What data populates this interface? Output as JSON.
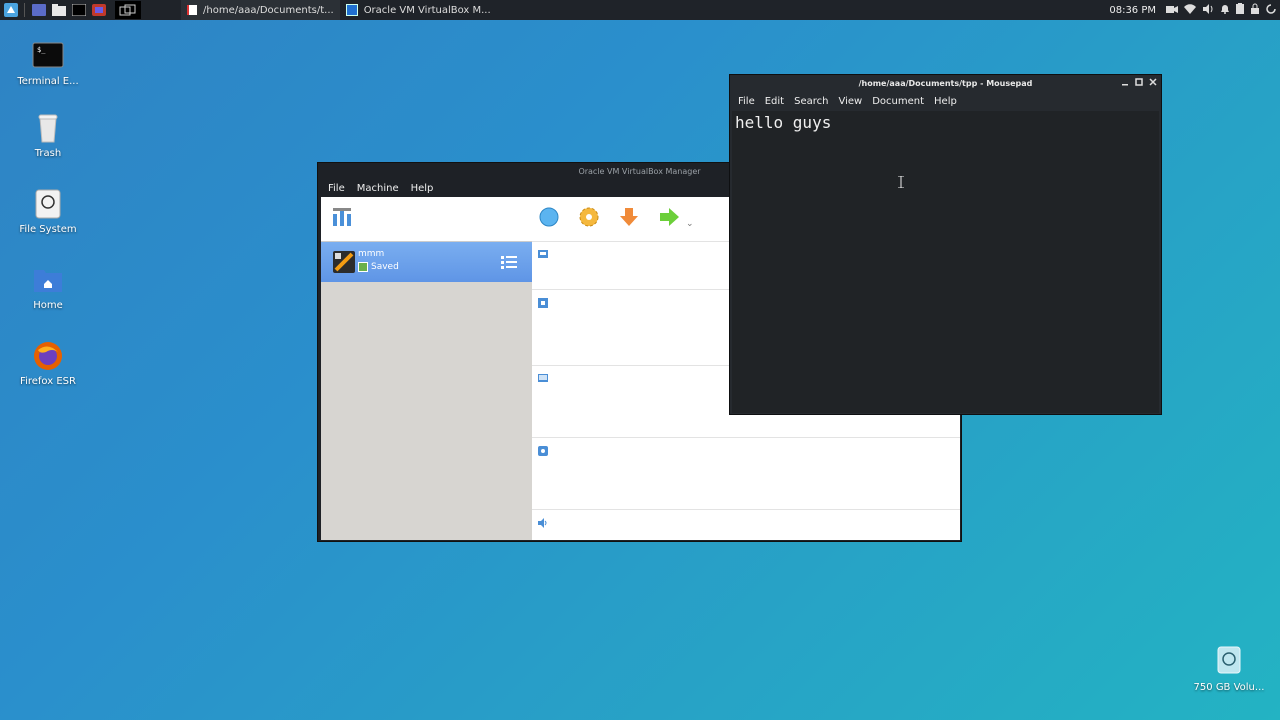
{
  "panel": {
    "tasks": [
      {
        "label": "/home/aaa/Documents/t..."
      },
      {
        "label": "Oracle VM VirtualBox M..."
      }
    ],
    "clock": "08:36 PM"
  },
  "desktop": {
    "icons": [
      {
        "label": "Terminal E..."
      },
      {
        "label": "Trash"
      },
      {
        "label": "File System"
      },
      {
        "label": "Home"
      },
      {
        "label": "Firefox ESR"
      }
    ],
    "volume_label": "750 GB Volu..."
  },
  "virtualbox": {
    "title": "Oracle VM VirtualBox Manager",
    "menu": [
      "File",
      "Machine",
      "Help"
    ],
    "vm": {
      "name": "mmm",
      "state": "Saved"
    }
  },
  "mousepad": {
    "title": "/home/aaa/Documents/tpp - Mousepad",
    "menu": [
      "File",
      "Edit",
      "Search",
      "View",
      "Document",
      "Help"
    ],
    "content": "hello guys"
  },
  "colors": {
    "panel_bg": "#1f2329",
    "selection": "#6aa0ea",
    "window_dark": "#262a2f"
  }
}
